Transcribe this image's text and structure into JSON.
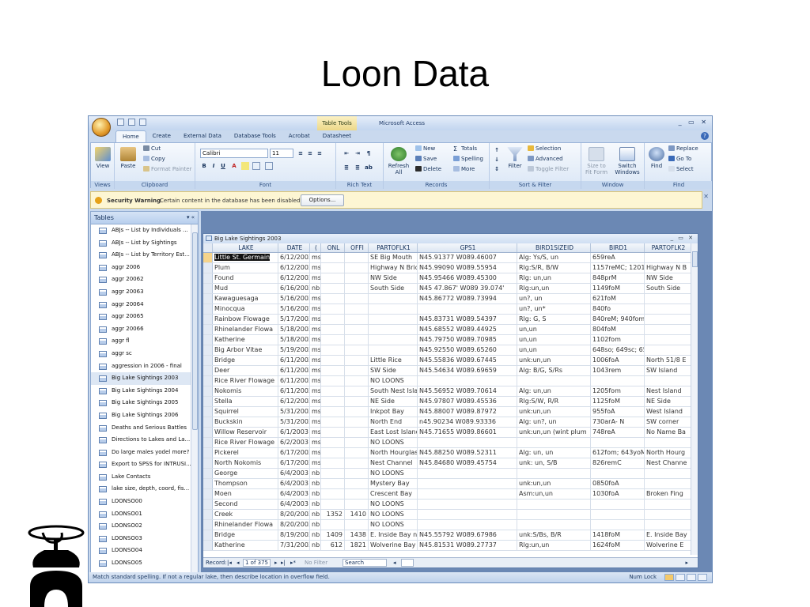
{
  "slide": {
    "title": "Loon Data"
  },
  "window": {
    "title": "Microsoft Access",
    "contextual_tab_title": "Table Tools",
    "controls": "_ ▭ ✕"
  },
  "ribbon_tabs": [
    "Home",
    "Create",
    "External Data",
    "Database Tools",
    "Acrobat",
    "Datasheet"
  ],
  "ribbon": {
    "views": {
      "view_label": "View",
      "group": "Views"
    },
    "clipboard": {
      "paste": "Paste",
      "cut": "Cut",
      "copy": "Copy",
      "format_painter": "Format Painter",
      "group": "Clipboard"
    },
    "font": {
      "font_name": "Calibri",
      "font_size": "11",
      "group": "Font"
    },
    "rich_text": {
      "group": "Rich Text"
    },
    "records": {
      "refresh": "Refresh All",
      "new": "New",
      "save": "Save",
      "delete": "Delete",
      "totals": "Totals",
      "spelling": "Spelling",
      "more": "More",
      "group": "Records"
    },
    "sort_filter": {
      "filter": "Filter",
      "selection": "Selection",
      "advanced": "Advanced",
      "toggle_filter": "Toggle Filter",
      "group": "Sort & Filter"
    },
    "window": {
      "size_to_fit": "Size to Fit Form",
      "switch_windows": "Switch Windows",
      "group": "Window"
    },
    "find": {
      "find": "Find",
      "replace": "Replace",
      "goto": "Go To",
      "select": "Select",
      "group": "Find"
    }
  },
  "security": {
    "title": "Security Warning",
    "message": "Certain content in the database has been disabled",
    "options_button": "Options..."
  },
  "nav": {
    "header": "Tables",
    "items": [
      "ABJs -- List by Individuals ...",
      "ABJs -- List by Sightings",
      "ABJs -- List by Territory Est...",
      "aggr 2006",
      "aggr 20062",
      "aggr 20063",
      "aggr 20064",
      "aggr 20065",
      "aggr 20066",
      "aggr fl",
      "aggr sc",
      "aggression in 2006 - final",
      "Big Lake Sightings 2003",
      "Big Lake Sightings 2004",
      "Big Lake Sightings 2005",
      "Big Lake Sightings 2006",
      "Deaths and Serious Battles",
      "Directions to Lakes and La...",
      "Do large males yodel more?",
      "Export to SPSS for INTRUSI...",
      "Lake Contacts",
      "lake size, depth, coord, fis...",
      "LOONSO00",
      "LOONSO01",
      "LOONSO02",
      "LOONSO03",
      "LOONSO04",
      "LOONSO05"
    ],
    "selected_index": 12
  },
  "datasheet": {
    "title": "Big Lake Sightings 2003",
    "columns": [
      "LAKE",
      "DATE",
      "(",
      "ONL",
      "OFFI",
      "PARTOFLK1",
      "GPS1",
      "BIRD1SIZEID",
      "BIRD1",
      "PARTOFLK2"
    ],
    "rows": [
      [
        "Little St. Germain",
        "6/12/2003",
        "ms",
        "",
        "",
        "SE Big Mouth",
        "N45.91377  W089.46007",
        "Alg: Ys/S, un",
        "659reA",
        ""
      ],
      [
        "Plum",
        "6/12/2003",
        "ms",
        "",
        "",
        "Highway N Bric",
        "N45.99090  W089.55954",
        "Rlg:S/R, B/W",
        "1157reMC; 1201y",
        "Highway N B"
      ],
      [
        "Found",
        "6/12/2003",
        "ms",
        "",
        "",
        "NW Side",
        "N45.95466  W089.45300",
        "Rlg: un,un",
        "848prM",
        "NW Side"
      ],
      [
        "Mud",
        "6/16/2003",
        "nb",
        "",
        "",
        "South Side",
        "N45 47.867'  W089 39.074'",
        "Rlg:un,un",
        "1149foM",
        "South Side"
      ],
      [
        "Kawaguesaga",
        "5/16/2003",
        "ms",
        "",
        "",
        "",
        "N45.86772  W089.73994",
        "un?, un",
        "621foM",
        ""
      ],
      [
        "Minocqua",
        "5/16/2003",
        "ms",
        "",
        "",
        "",
        "",
        "un?, un*",
        "840fo",
        ""
      ],
      [
        "Rainbow Flowage",
        "5/17/2003",
        "ms",
        "",
        "",
        "",
        "N45.83731  W089.54397",
        "Rlg: G, S",
        "840reM; 940fom",
        ""
      ],
      [
        "Rhinelander Flowa",
        "5/18/2003",
        "ms",
        "",
        "",
        "",
        "N45.68552  W089.44925",
        "un,un",
        "804foM",
        ""
      ],
      [
        "Katherine",
        "5/18/2003",
        "ms",
        "",
        "",
        "",
        "N45.79750  W089.70985",
        "un,un",
        "1102fom",
        ""
      ],
      [
        "Big Arbor Vitae",
        "5/19/2003",
        "ms",
        "",
        "",
        "",
        "N45.92550  W089.65260",
        "un,un",
        "648so; 649sc; 65€",
        ""
      ],
      [
        "Bridge",
        "6/11/2003",
        "ms",
        "",
        "",
        "Little Rice",
        "N45.55836  W089.67445",
        "unk:un,un",
        "1006foA",
        "North 51/8 E"
      ],
      [
        "Deer",
        "6/11/2003",
        "ms",
        "",
        "",
        "SW Side",
        "N45.54634  W089.69659",
        "Alg: B/G, S/Rs",
        "1043rem",
        "SW Island"
      ],
      [
        "Rice River Flowage",
        "6/11/2003",
        "ms",
        "",
        "",
        "NO LOONS",
        "",
        "",
        "",
        ""
      ],
      [
        "Nokomis",
        "6/11/2003",
        "ms",
        "",
        "",
        "South Nest Isla",
        "N45.56952  W089.70614",
        "Alg: un,un",
        "1205fom",
        "Nest Island"
      ],
      [
        "Stella",
        "6/12/2003",
        "ms",
        "",
        "",
        "NE Side",
        "N45.97807  W089.45536",
        "Rlg:S/W, R/R",
        "1125foM",
        "NE Side"
      ],
      [
        "Squirrel",
        "5/31/2003",
        "ms",
        "",
        "",
        "Inkpot Bay",
        "N45.88007  W089.87972",
        "unk:un,un",
        "955foA",
        "West Island"
      ],
      [
        "Buckskin",
        "5/31/2003",
        "ms",
        "",
        "",
        "North End",
        "n45.90234  W089.93336",
        "Alg: un?, un",
        "730arA- N",
        "SW corner"
      ],
      [
        "Willow Reservoir",
        "6/1/2003",
        "ms",
        "",
        "",
        "East Lost Island",
        "N45.71655  W089.86601",
        "unk:un,un (wint plum",
        "748reA",
        "No Name Ba"
      ],
      [
        "Rice River Flowage",
        "6/2/2003",
        "ms",
        "",
        "",
        "NO LOONS",
        "",
        "",
        "",
        ""
      ],
      [
        "Pickerel",
        "6/17/2003",
        "ms",
        "",
        "",
        "North Hourglas",
        "N45.88250  W089.52311",
        "Alg: un, un",
        "612fom; 643yoM",
        "North Hourg"
      ],
      [
        "North Nokomis",
        "6/17/2003",
        "ms",
        "",
        "",
        "Nest Channel",
        "N45.84680  W089.45754",
        "unk: un, S/B",
        "826remC",
        "Nest Channe"
      ],
      [
        "George",
        "6/4/2003",
        "nb",
        "",
        "",
        "NO LOONS",
        "",
        "",
        "",
        ""
      ],
      [
        "Thompson",
        "6/4/2003",
        "nb",
        "",
        "",
        "Mystery Bay",
        "",
        "unk:un,un",
        "0850foA",
        ""
      ],
      [
        "Moen",
        "6/4/2003",
        "nb",
        "",
        "",
        "Crescent Bay",
        "",
        "Asm:un,un",
        "1030foA",
        "Broken Fing"
      ],
      [
        "Second",
        "6/4/2003",
        "nb",
        "",
        "",
        "NO LOONS",
        "",
        "",
        "",
        ""
      ],
      [
        "Creek",
        "8/20/2003",
        "nb",
        "1352",
        "1410",
        "NO LOONS",
        "",
        "",
        "",
        ""
      ],
      [
        "Rhinelander Flowa",
        "8/20/2003",
        "nb",
        "",
        "",
        "NO LOONS",
        "",
        "",
        "",
        ""
      ],
      [
        "Bridge",
        "8/19/2003",
        "nb",
        "1409",
        "1438",
        "E. Inside Bay ne",
        "N45.55792  W089.67986",
        "unk:S/Bs, B/R",
        "1418foM",
        "E. Inside Bay"
      ],
      [
        "Katherine",
        "7/31/2003",
        "nb",
        "612",
        "1821",
        "Wolverine Bay",
        "N45.81531  W089.27737",
        "Rlg:un,un",
        "1624foM",
        "Wolverine E"
      ]
    ],
    "record_nav": {
      "record_label": "Record:",
      "position": "1 of 375",
      "no_filter": "No Filter",
      "search": "Search"
    }
  },
  "status": {
    "message": "Match standard spelling. If not a regular lake, then describe location in overflow field.",
    "num_lock": "Num Lock"
  },
  "colors": {
    "ribbon_blue": "#c9d9ee",
    "work_area": "#6b88b4",
    "selected_cell": "#111111"
  }
}
